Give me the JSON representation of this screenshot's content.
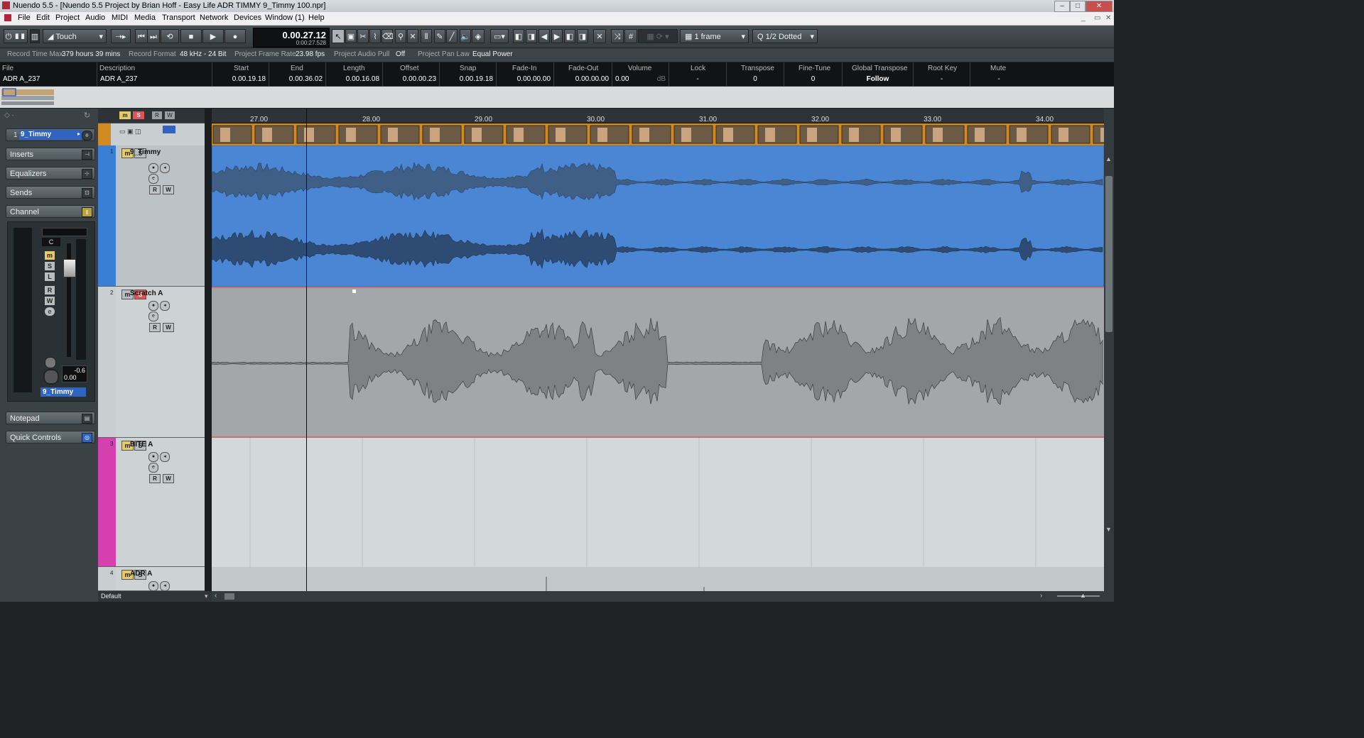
{
  "window": {
    "title": "Nuendo 5.5 - [Nuendo 5.5 Project by Brian Hoff - Easy Life ADR TIMMY 9_Timmy 100.npr]"
  },
  "menu": [
    "File",
    "Edit",
    "Project",
    "Audio",
    "MIDI",
    "Media",
    "Transport",
    "Network",
    "Devices",
    "Window (1)",
    "Help"
  ],
  "toolbar": {
    "automation_mode": "Touch",
    "time_main": "0.00.27.12",
    "time_sub": "0:00:27.528",
    "quantize_grid": "1 frame",
    "quantize_value": "1/2  Dotted"
  },
  "info_line": {
    "record_time_label": "Record Time Max",
    "record_time_value": "379 hours 39 mins",
    "record_format_label": "Record Format",
    "record_format_value": "48 kHz - 24 Bit",
    "frame_rate_label": "Project Frame Rate",
    "frame_rate_value": "23.98 fps",
    "audio_pull_label": "Project Audio Pull",
    "audio_pull_value": "Off",
    "pan_law_label": "Project Pan Law",
    "pan_law_value": "Equal Power"
  },
  "event_info": {
    "file_h": "File",
    "file_v": "ADR A_237",
    "desc_h": "Description",
    "desc_v": "ADR A_237",
    "start_h": "Start",
    "start_v": "0.00.19.18",
    "end_h": "End",
    "end_v": "0.00.36.02",
    "length_h": "Length",
    "length_v": "0.00.16.08",
    "offset_h": "Offset",
    "offset_v": "0.00.00.23",
    "snap_h": "Snap",
    "snap_v": "0.00.19.18",
    "fadein_h": "Fade-In",
    "fadein_v": "0.00.00.00",
    "fadeout_h": "Fade-Out",
    "fadeout_v": "0.00.00.00",
    "volume_h": "Volume",
    "volume_v": "0.00",
    "volume_unit": "dB",
    "lock_h": "Lock",
    "lock_v": "-",
    "transpose_h": "Transpose",
    "transpose_v": "0",
    "finetune_h": "Fine-Tune",
    "finetune_v": "0",
    "gtranspose_h": "Global Transpose",
    "gtranspose_v": "Follow",
    "rootkey_h": "Root Key",
    "rootkey_v": "-",
    "mute_h": "Mute",
    "mute_v": "-"
  },
  "inspector": {
    "track_num": "1",
    "track_name": "9_Timmy",
    "sections": [
      "Inserts",
      "Equalizers",
      "Sends",
      "Channel",
      "Notepad",
      "Quick Controls"
    ],
    "pan_value": "C",
    "peak_value": "-0.6",
    "fader_value": "0.00",
    "channel_name": "9_Timmy"
  },
  "ruler": [
    "27.00",
    "28.00",
    "29.00",
    "30.00",
    "31.00",
    "32.00",
    "33.00",
    "34.00"
  ],
  "tracks": [
    {
      "num": "1",
      "name": "9_Timmy",
      "color": "#3a7fd6"
    },
    {
      "num": "2",
      "name": "Scratch A",
      "color": "#c9cfd1"
    },
    {
      "num": "3",
      "name": "BITE A",
      "color": "#d63fb0"
    },
    {
      "num": "4",
      "name": "ADR A",
      "color": "#c9cfd1"
    }
  ],
  "buttons": {
    "mute": "m",
    "solo": "S",
    "read": "R",
    "write": "W"
  },
  "bottom": {
    "preset": "Default"
  },
  "colors": {
    "selected_region": "#4a86d4",
    "video_track": "#d08a20",
    "bite_track": "#d63fb0"
  }
}
